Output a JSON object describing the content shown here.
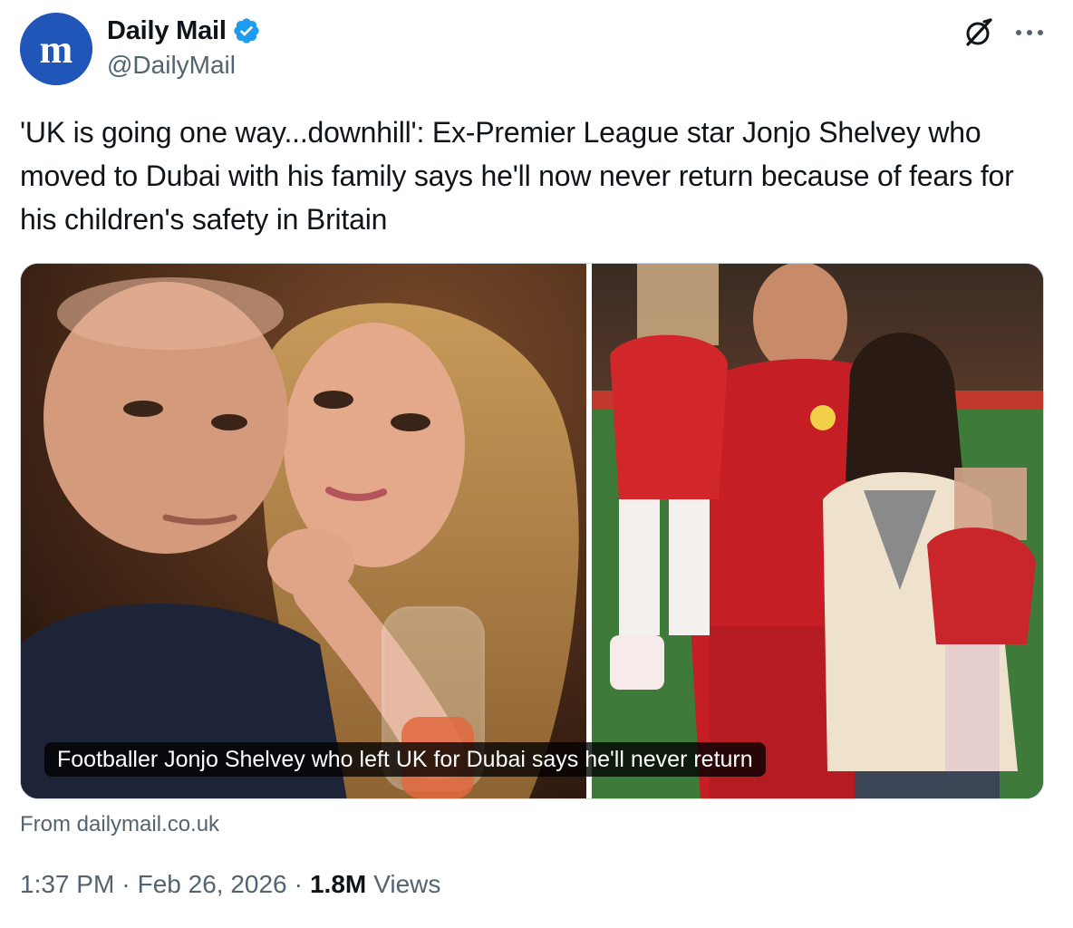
{
  "author": {
    "display_name": "Daily Mail",
    "handle": "@DailyMail",
    "verified": true,
    "avatar_icon": "daily-mail-logo",
    "avatar_color": "#1f56b8",
    "verified_color": "#1d9bf0"
  },
  "tweet": {
    "text": "'UK is going one way...downhill': Ex-Premier League star Jonjo Shelvey who moved to Dubai with his family says he'll now never return because of fears for his children's safety in Britain"
  },
  "media": {
    "caption": "Footballer Jonjo Shelvey who left UK for Dubai says he'll never return",
    "left_photo_icon": "couple-selfie-photo",
    "right_photo_icon": "family-on-pitch-photo"
  },
  "card": {
    "source": "From dailymail.co.uk"
  },
  "meta": {
    "time": "1:37 PM",
    "separator": "·",
    "date": "Feb 26, 2026",
    "views_count": "1.8M",
    "views_label": "Views"
  },
  "actions": {
    "grok_icon": "grok-icon",
    "more_icon": "more-icon"
  }
}
